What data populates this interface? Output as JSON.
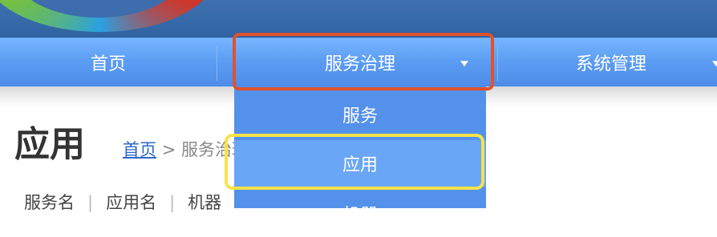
{
  "nav": {
    "items": [
      {
        "label": "首页"
      },
      {
        "label": "服务治理",
        "has_dropdown": true
      },
      {
        "label": "系统管理",
        "has_dropdown": true
      }
    ]
  },
  "dropdown": {
    "items": [
      {
        "label": "服务"
      },
      {
        "label": "应用",
        "hovered": true
      },
      {
        "label": "机器"
      }
    ]
  },
  "page": {
    "title": "应用",
    "breadcrumb": {
      "home": "首页",
      "sep": ">",
      "current": "服务治理"
    }
  },
  "tabs": [
    "服务名",
    "应用名",
    "机器"
  ],
  "colors": {
    "nav_bg": "#5d9ef3",
    "header_bg": "#356aa9",
    "highlight_red": "#e0522f",
    "highlight_yellow": "#f7e24a"
  }
}
